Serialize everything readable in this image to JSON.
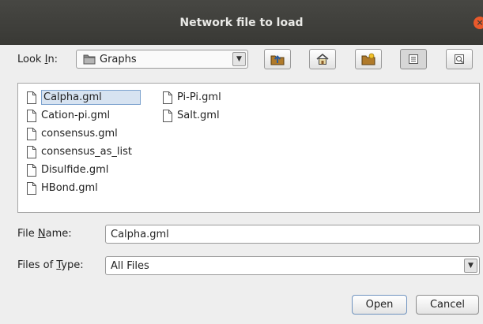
{
  "window": {
    "title": "Network file to load",
    "close_glyph": "×"
  },
  "look_in": {
    "label_pre": "Look ",
    "label_mnemonic": "I",
    "label_post": "n:",
    "value": "Graphs"
  },
  "toolbar": {
    "icons": [
      "up-one-level-icon",
      "home-icon",
      "new-folder-icon",
      "list-view-icon",
      "details-view-icon"
    ],
    "selected_view": "list"
  },
  "files": {
    "items": [
      {
        "name": "Calpha.gml",
        "selected": true
      },
      {
        "name": "Cation-pi.gml"
      },
      {
        "name": "consensus.gml"
      },
      {
        "name": "consensus_as_list"
      },
      {
        "name": "Disulfide.gml"
      },
      {
        "name": "HBond.gml"
      },
      {
        "name": "Pi-Pi.gml"
      },
      {
        "name": "Salt.gml"
      }
    ]
  },
  "file_name": {
    "label_pre": "File ",
    "label_mnemonic": "N",
    "label_post": "ame:",
    "value": "Calpha.gml"
  },
  "file_type": {
    "label_pre": "Files of ",
    "label_mnemonic": "T",
    "label_post": "ype:",
    "value": "All Files"
  },
  "buttons": {
    "open": "Open",
    "cancel": "Cancel"
  },
  "colors": {
    "titlebar": "#3f3f3b",
    "close": "#e9592b",
    "selection": "#d7e3f1"
  }
}
